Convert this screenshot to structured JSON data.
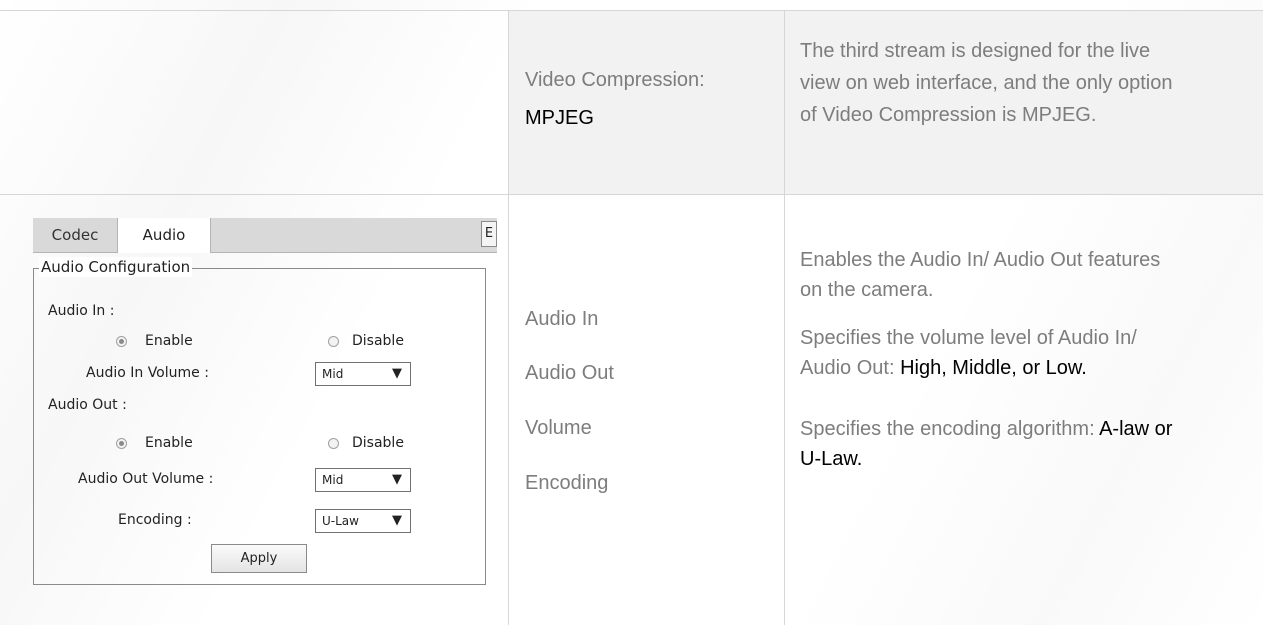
{
  "row1": {
    "param_label": "Video Compression:",
    "param_value": "MPJEG",
    "description": [
      "The third stream is designed for the live",
      "view on web interface, and the only option",
      "of Video Compression is MPJEG."
    ]
  },
  "row2": {
    "params": [
      "Audio In",
      "Audio Out",
      "Volume",
      "Encoding"
    ],
    "desc1": [
      "Enables the Audio In/ Audio Out features",
      "on the camera."
    ],
    "desc2_line1": "Specifies the volume level of Audio In/",
    "desc2_line2_grey": "Audio Out: ",
    "desc2_line2_dark": "High, Middle, or Low.",
    "desc3_line1_grey": "Specifies the encoding algorithm: ",
    "desc3_line1_dark": "A-law or",
    "desc3_line2_dark": "U-Law."
  },
  "ui_panel": {
    "tabs": [
      "Codec",
      "Audio"
    ],
    "tab_edge": "E",
    "legend": "Audio Configuration",
    "audio_in_label": "Audio In :",
    "enable": "Enable",
    "disable": "Disable",
    "audio_in_volume_label": "Audio In Volume :",
    "audio_in_volume": "Mid",
    "audio_out_label": "Audio Out :",
    "audio_out_volume_label": "Audio Out Volume :",
    "audio_out_volume": "Mid",
    "encoding_label": "Encoding :",
    "encoding": "U-Law",
    "dropdown_glyph": "▼",
    "apply": "Apply",
    "audio_in_enabled": true,
    "audio_out_enabled": true
  }
}
